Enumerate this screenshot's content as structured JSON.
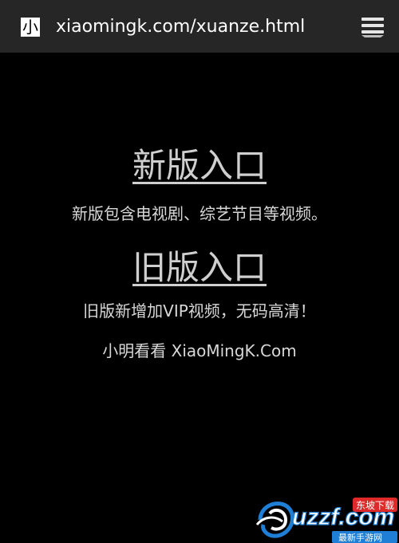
{
  "browser": {
    "favicon_char": "小",
    "url": "xiaomingk.com/xuanze.html",
    "menu_icon": "menu-icon"
  },
  "main": {
    "new_entry": {
      "label": "新版入口",
      "description": "新版包含电视剧、综艺节目等视频。"
    },
    "old_entry": {
      "label": "旧版入口",
      "description": "旧版新增加VIP视频，无码高清！"
    },
    "footer": "小明看看 XiaoMingK.Com"
  },
  "watermark": {
    "brand": "uzzf.com",
    "tag_top": "东坡下载",
    "tag_bottom": "最新手游网"
  },
  "colors": {
    "background": "#000000",
    "topbar": "#262626",
    "link_text": "#cfcfcf",
    "body_text": "#d8d8d8",
    "watermark_blue": "#1f7fd6",
    "watermark_red": "#e02a2a"
  }
}
